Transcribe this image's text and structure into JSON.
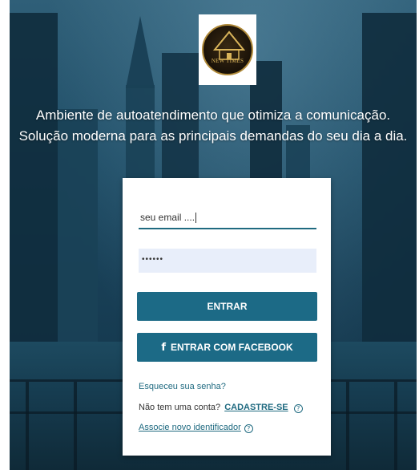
{
  "brand": {
    "logo_text": "NEW TIMES",
    "logo_icon": "new-times-emblem"
  },
  "tagline": {
    "line1": "Ambiente de autoatendimento que otimiza a comunicação.",
    "line2": "Solução moderna para as principais demandas do seu dia a dia."
  },
  "login": {
    "email_value": "seu email ....",
    "password_mask": "••••••",
    "enter_label": "ENTRAR",
    "facebook_label": "ENTRAR COM FACEBOOK",
    "facebook_icon": "f",
    "forgot_label": "Esqueceu sua senha?",
    "no_account_label": "Não tem uma conta?",
    "signup_label": "CADASTRE-SE",
    "associate_label": "Associe novo identificador",
    "help_icon": "?"
  },
  "colors": {
    "primary": "#1c6a86",
    "link": "#1f6a80",
    "password_bg": "#e8eefa"
  }
}
